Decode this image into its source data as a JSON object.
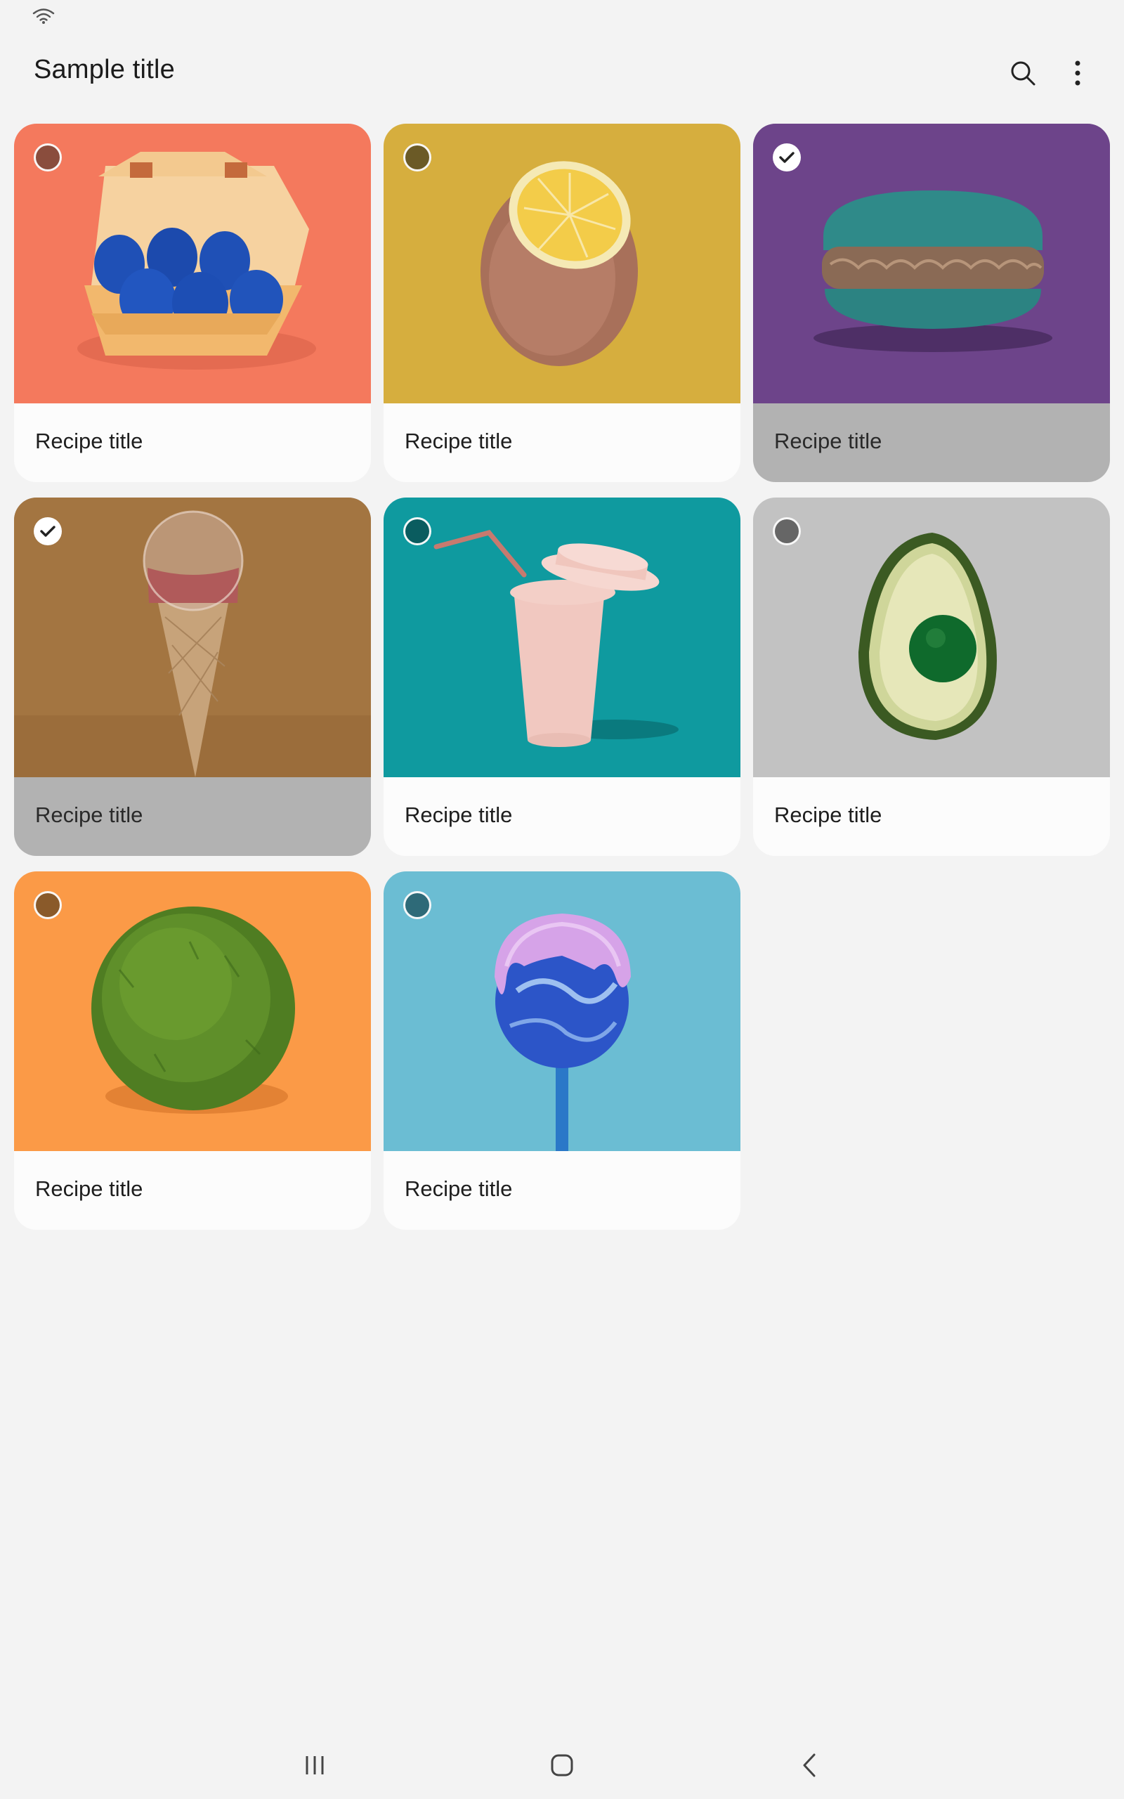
{
  "status": {
    "wifi_icon": "wifi-icon"
  },
  "app_bar": {
    "title": "Sample title",
    "search_icon": "search-icon",
    "more_icon": "more-vert-icon"
  },
  "cards": [
    {
      "label": "Recipe title",
      "selected": false,
      "image": "blue-eggs-in-carton",
      "bg": "#f4795d"
    },
    {
      "label": "Recipe title",
      "selected": false,
      "image": "half-lemon",
      "bg": "#d6ae3e"
    },
    {
      "label": "Recipe title",
      "selected": true,
      "image": "teal-macaron",
      "bg": "#6d448a"
    },
    {
      "label": "Recipe title",
      "selected": true,
      "image": "ice-cream-cone-bubble",
      "bg": "#a37541"
    },
    {
      "label": "Recipe title",
      "selected": false,
      "image": "pink-cup-with-straw",
      "bg": "#0f9a9f"
    },
    {
      "label": "Recipe title",
      "selected": false,
      "image": "avocado-half",
      "bg": "#c2c2c2"
    },
    {
      "label": "Recipe title",
      "selected": false,
      "image": "green-moss-ball",
      "bg": "#fb9a47"
    },
    {
      "label": "Recipe title",
      "selected": false,
      "image": "lollipop",
      "bg": "#6bbdd3"
    }
  ],
  "nav": {
    "recents_icon": "recents-icon",
    "home_icon": "home-icon",
    "back_icon": "back-icon"
  }
}
